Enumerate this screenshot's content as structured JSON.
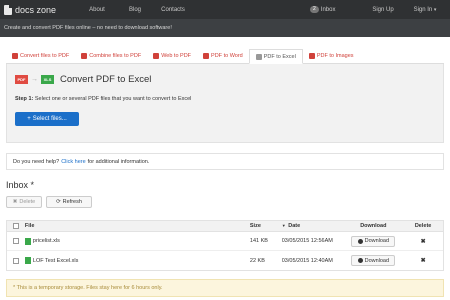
{
  "navbar": {
    "brand": "docs zone",
    "links": [
      "About",
      "Blog",
      "Contacts"
    ],
    "inbox_count": "2",
    "inbox_label": "Inbox",
    "signup": "Sign Up",
    "signin": "Sign In"
  },
  "subbar": {
    "text": "Create and convert PDF files online – no need to download software!"
  },
  "tabs": [
    {
      "label": "Convert files to PDF",
      "icon": "pdf-icon"
    },
    {
      "label": "Combine files to PDF",
      "icon": "pdf-icon"
    },
    {
      "label": "Web to PDF",
      "icon": "web-icon"
    },
    {
      "label": "PDF to Word",
      "icon": "pdf-icon"
    },
    {
      "label": "PDF to Excel",
      "icon": "pdf-icon",
      "active": true
    },
    {
      "label": "PDF to Images",
      "icon": "pdf-icon"
    }
  ],
  "converter": {
    "from_label": "PDF",
    "to_label": "XLS",
    "title": "Convert PDF to Excel",
    "step_label": "Step 1:",
    "step_text": "Select one or several PDF files that you want to convert to Excel",
    "select_button": "Select files..."
  },
  "help": {
    "prefix": "Do you need help?",
    "link": "Click here",
    "suffix": "for additional information."
  },
  "inbox": {
    "title": "Inbox *",
    "delete_button": "Delete",
    "refresh_button": "Refresh",
    "columns": {
      "file": "File",
      "size": "Size",
      "date": "Date",
      "download": "Download",
      "delete": "Delete"
    },
    "rows": [
      {
        "file": "pricelist.xls",
        "size": "141 KB",
        "date": "03/05/2015 12:56AM",
        "download": "Download"
      },
      {
        "file": "LOF Test Excel.xls",
        "size": "22 KB",
        "date": "03/05/2015 12:40AM",
        "download": "Download"
      }
    ]
  },
  "notice": {
    "text": "* This is a temporary storage. Files stay here for 6 hours only."
  },
  "colors": {
    "accent": "#1b6fc9",
    "pdf_red": "#d0413a",
    "excel_green": "#3aa84a",
    "navbar": "#2f3133"
  }
}
